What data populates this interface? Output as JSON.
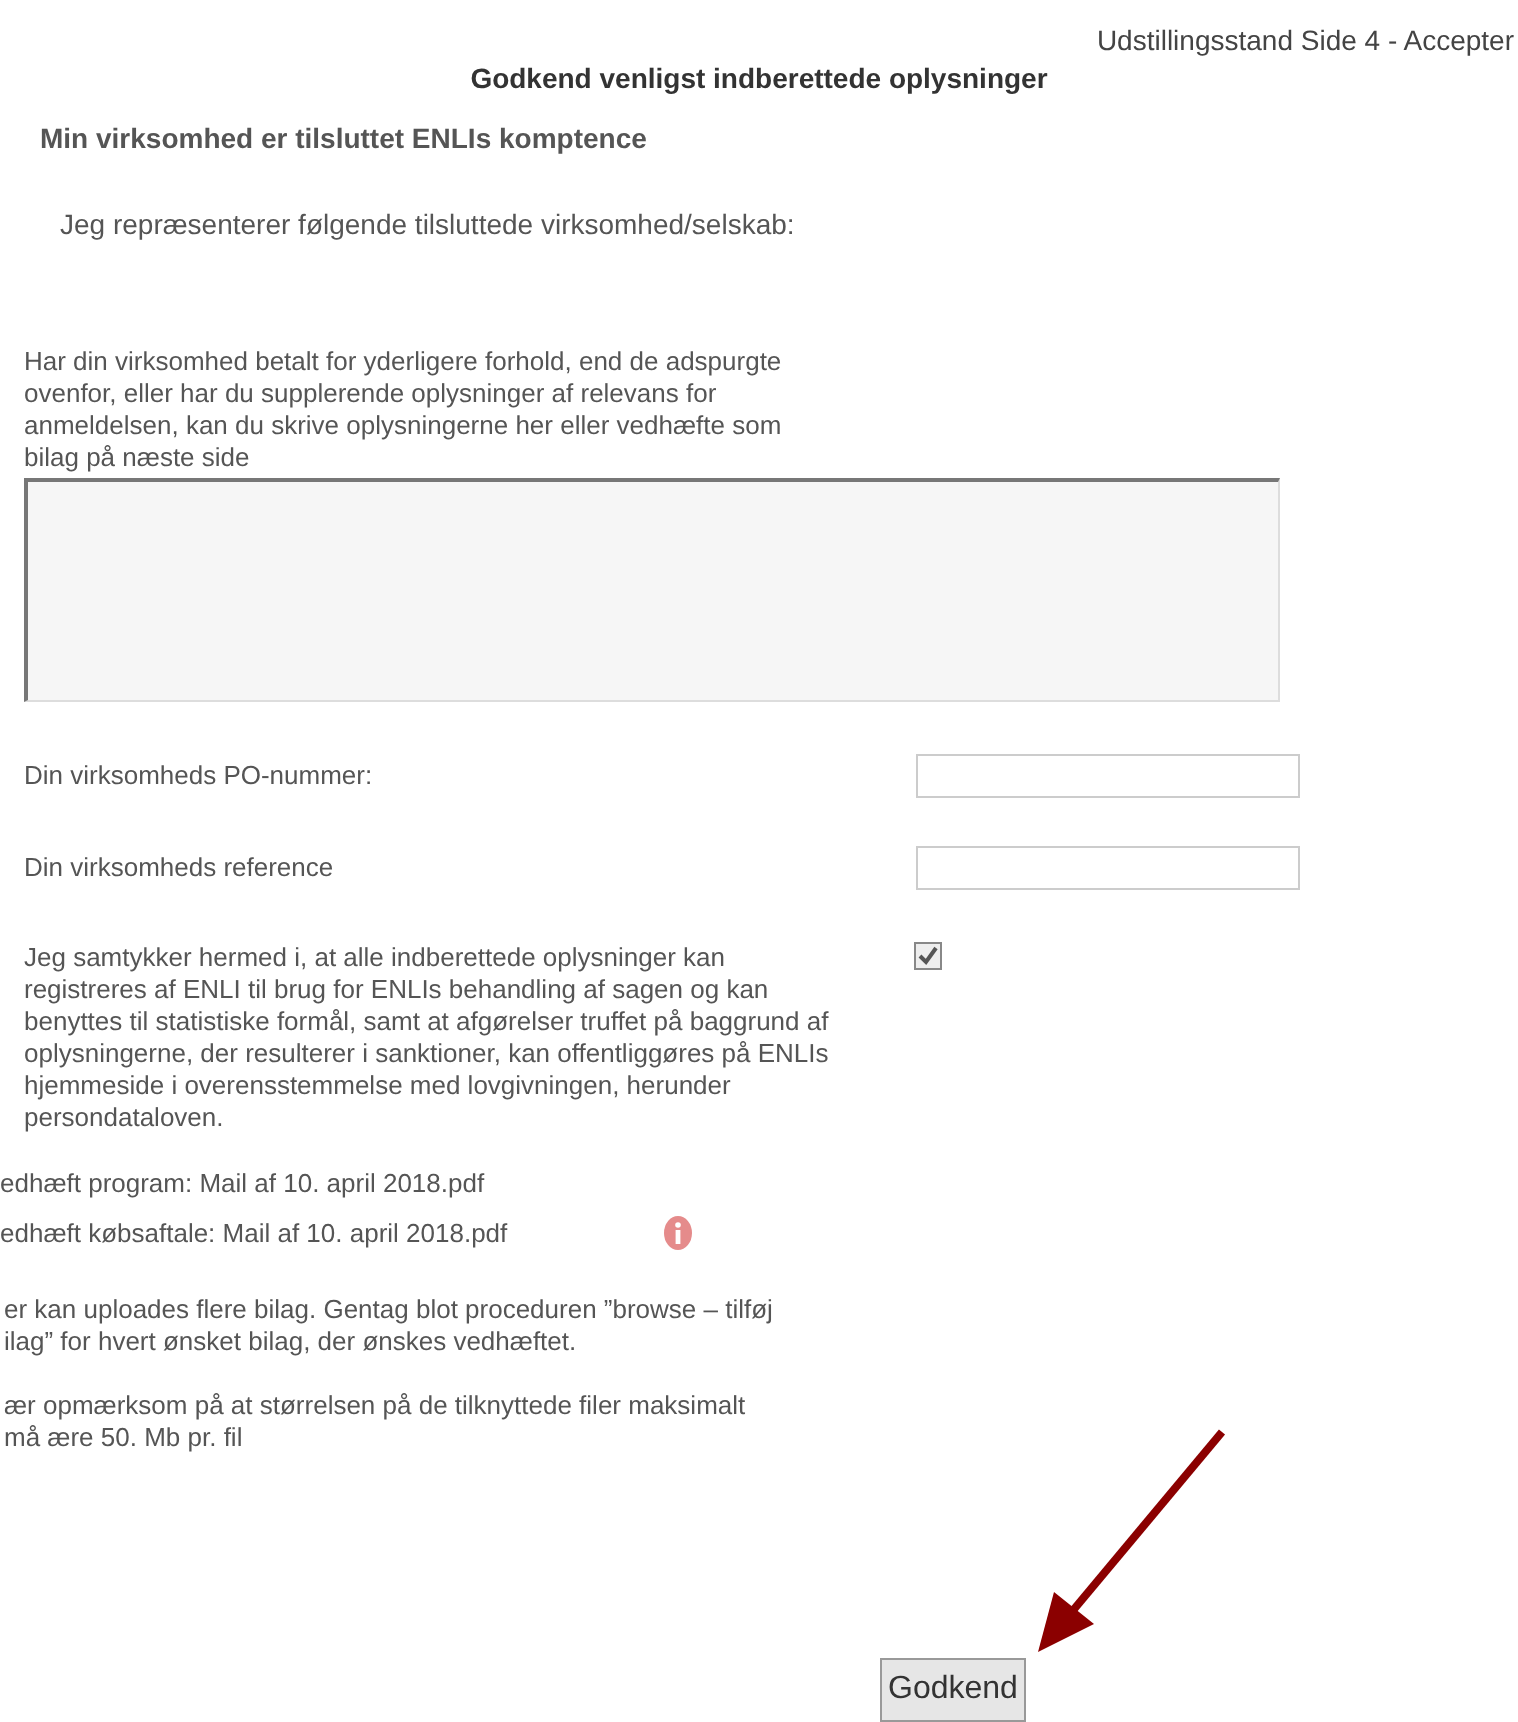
{
  "breadcrumb": "Udstillingsstand Side 4 - Accepter",
  "title": "Godkend venligst indberettede oplysninger",
  "section_heading": "Min virksomhed er tilsluttet ENLIs komptence",
  "represent_text": "Jeg repræsenterer følgende tilsluttede virksomhed/selskab:",
  "extra_info": {
    "label": "Har din virksomhed betalt for yderligere forhold, end de adspurgte ovenfor, eller har du supplerende oplysninger af relevans for anmeldelsen, kan du skrive oplysningerne her eller vedhæfte som bilag på næste side"
  },
  "fields": [
    {
      "label": "Din virksomheds PO-nummer:"
    },
    {
      "label": "Din virksomheds reference"
    }
  ],
  "consent": {
    "text": "Jeg samtykker hermed i, at alle indberettede oplysninger kan registreres af ENLI til brug for ENLIs behandling af sagen og kan benyttes til statistiske formål, samt at afgørelser truffet på baggrund af oplysningerne, der resulterer i sanktioner, kan offentliggøres på ENLIs hjemmeside i overensstemmelse med lovgivningen, herunder persondataloven.",
    "checked": true
  },
  "attachments": [
    {
      "text": "edhæft program: Mail af 10. april 2018.pdf",
      "info": false
    },
    {
      "text": "edhæft købsaftale: Mail af 10. april 2018.pdf",
      "info": true
    }
  ],
  "notes": [
    "er kan uploades flere bilag. Gentag blot proceduren ”browse – tilføj ilag” for hvert ønsket bilag, der ønskes vedhæftet.",
    "ær opmærksom på at størrelsen på de tilknyttede filer maksimalt må ære 50. Mb pr. fil"
  ],
  "submit_button": "Godkend"
}
